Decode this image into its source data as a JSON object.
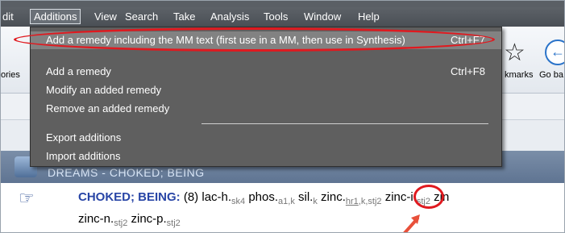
{
  "menubar": {
    "items": [
      "dit",
      "Additions",
      "View",
      "Search",
      "Take",
      "Analysis",
      "Tools",
      "Window",
      "Help"
    ]
  },
  "toolbar": {
    "left_label": "ories",
    "bookmarks_label": "kmarks",
    "goback_label": "Go ba"
  },
  "additions_menu": {
    "items": [
      {
        "label": "Add a remedy including the MM text (first use in a MM, then use in Synthesis)",
        "shortcut": "Ctrl+F7"
      },
      {
        "label": "Add a remedy",
        "shortcut": "Ctrl+F8"
      },
      {
        "label": "Modify an added remedy",
        "shortcut": ""
      },
      {
        "label": "Remove an added remedy",
        "shortcut": ""
      },
      {
        "label": "Export additions",
        "shortcut": ""
      },
      {
        "label": "Import additions",
        "shortcut": ""
      }
    ]
  },
  "rubric_header": {
    "text": "DREAMS - CHOKED; BEING"
  },
  "rubric": {
    "name": "CHOKED; BEING:",
    "count": "(8)",
    "remedies": [
      {
        "name": "lac-h.",
        "authors": "sk4"
      },
      {
        "name": "phos.",
        "authors": "a1,k"
      },
      {
        "name": "sil.",
        "authors": "k"
      },
      {
        "name": "zinc.",
        "authors_hl": "hr1",
        "authors": ",k,stj2"
      },
      {
        "name": "zinc-i.",
        "authors": "stj2"
      },
      {
        "name": "zin",
        "authors": ""
      },
      {
        "name": "zinc-n.",
        "authors": "stj2"
      },
      {
        "name": "zinc-p.",
        "authors": "stj2"
      }
    ]
  },
  "colors": {
    "highlight_red": "#e0191f",
    "menu_bg": "#5f5f5f",
    "rubric_blue": "#2845a6"
  }
}
